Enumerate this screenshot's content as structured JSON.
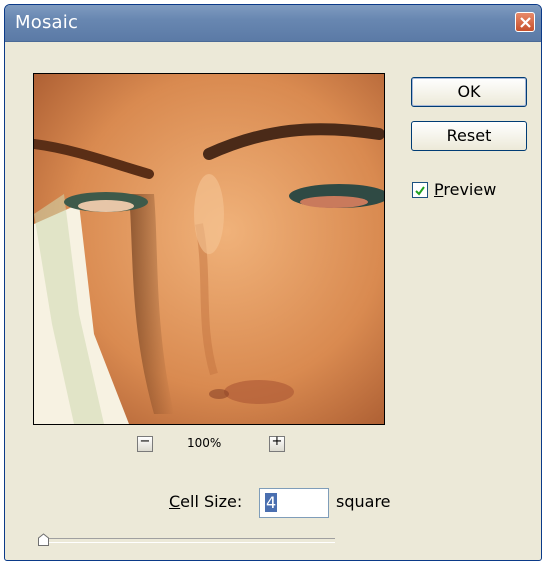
{
  "window": {
    "title": "Mosaic"
  },
  "buttons": {
    "ok_label": "OK",
    "reset_label": "Reset"
  },
  "preview_checkbox": {
    "label_accesskey": "P",
    "label_rest": "review",
    "checked": true
  },
  "zoom": {
    "minus": "−",
    "plus": "+",
    "level": "100%"
  },
  "cell_size": {
    "label_accesskey": "C",
    "label_rest": "ell Size:",
    "value": "4",
    "unit": "square"
  },
  "slider": {
    "value": 4
  },
  "colors": {
    "titlebar": "#6887b1",
    "dialog_bg": "#ece9d8",
    "skin": "#d9895a",
    "brow": "#4a2a18"
  },
  "icons": {
    "close": "close-icon",
    "check": "check-icon",
    "slider_thumb": "slider-thumb-icon"
  }
}
